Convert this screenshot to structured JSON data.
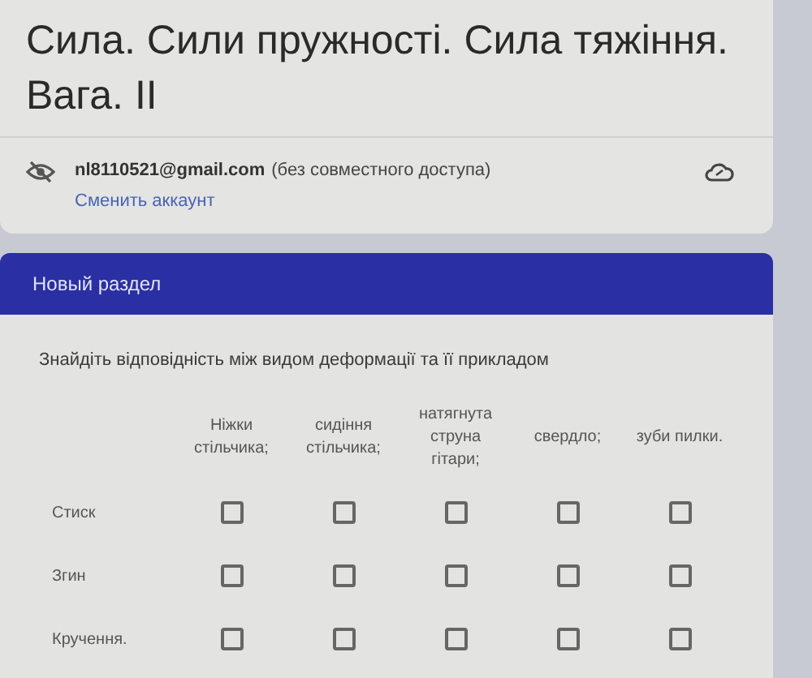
{
  "form": {
    "title": "Сила. Сили пружності. Сила тяжіння. Вага. ІІ"
  },
  "account": {
    "email": "nl8110521@gmail.com",
    "sharing": "(без совместного доступа)",
    "switch_link": "Сменить аккаунт"
  },
  "section": {
    "title": "Новый раздел"
  },
  "question": {
    "text": "Знайдіть відповідність між видом деформації та її прикладом",
    "columns": [
      "Ніжки стільчика;",
      "сидіння стільчика;",
      "натягнута струна гітари;",
      "свердло;",
      "зуби пилки."
    ],
    "rows": [
      {
        "label": "Стиск",
        "checked": [
          false,
          false,
          false,
          false,
          false
        ]
      },
      {
        "label": "Згин",
        "checked": [
          false,
          false,
          false,
          false,
          false
        ]
      },
      {
        "label": "Кручення.",
        "checked": [
          false,
          false,
          false,
          false,
          false
        ]
      }
    ]
  }
}
